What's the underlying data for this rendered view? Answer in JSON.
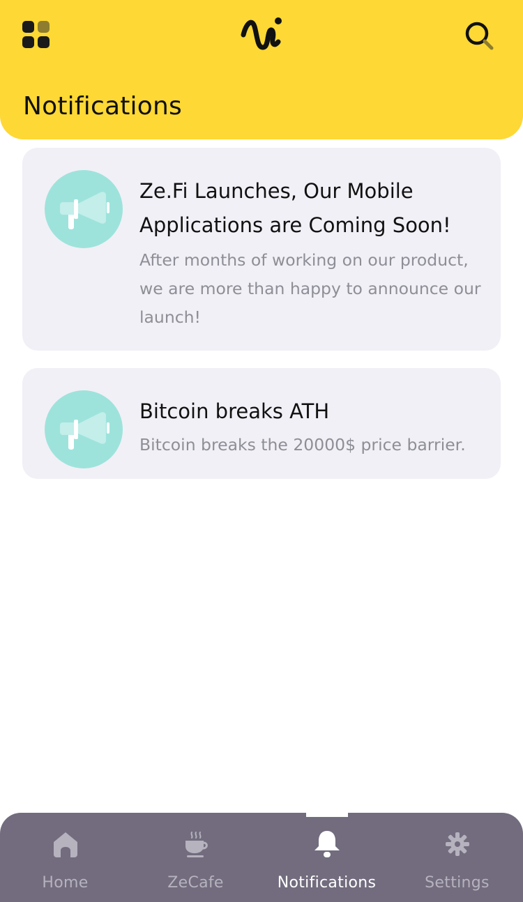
{
  "header": {
    "title": "Notifications",
    "accent_color": "#FED834",
    "menu_icon": "grid-icon",
    "logo_icon": "zefi-logo",
    "search_icon": "search-icon"
  },
  "notifications": [
    {
      "title": "Ze.Fi Launches, Our Mobile Applications are Coming Soon!",
      "body": "After months of working on our product, we are more than happy to announce our launch!",
      "icon": "megaphone-icon"
    },
    {
      "title": "Bitcoin breaks ATH",
      "body": "Bitcoin breaks the 20000$ price barrier.",
      "icon": "megaphone-icon"
    }
  ],
  "tabbar": {
    "items": [
      {
        "label": "Home",
        "icon": "home-icon"
      },
      {
        "label": "ZeCafe",
        "icon": "coffee-cup-icon"
      },
      {
        "label": "Notifications",
        "icon": "bell-icon",
        "active": true
      },
      {
        "label": "Settings",
        "icon": "gear-icon"
      }
    ],
    "background": "#726C7E"
  }
}
